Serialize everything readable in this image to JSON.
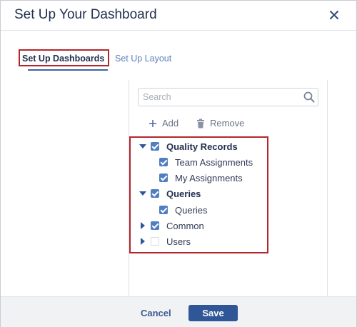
{
  "dialog": {
    "title": "Set Up Your Dashboard",
    "close_icon": "close-icon"
  },
  "tabs": [
    {
      "label": "Set Up Dashboards",
      "active": true
    },
    {
      "label": "Set Up Layout",
      "active": false
    }
  ],
  "search": {
    "placeholder": "Search",
    "value": "",
    "icon": "search-icon"
  },
  "actions": {
    "add_label": "Add",
    "add_icon": "plus-icon",
    "remove_label": "Remove",
    "remove_icon": "trash-icon"
  },
  "tree": [
    {
      "label": "Quality Records",
      "level": 0,
      "expanded": true,
      "checked": true
    },
    {
      "label": "Team Assignments",
      "level": 1,
      "checked": true
    },
    {
      "label": "My Assignments",
      "level": 1,
      "checked": true
    },
    {
      "label": "Queries",
      "level": 0,
      "expanded": true,
      "checked": true
    },
    {
      "label": "Queries",
      "level": 1,
      "checked": true
    },
    {
      "label": "Common",
      "level": 0,
      "expanded": false,
      "checked": true
    },
    {
      "label": "Users",
      "level": 0,
      "expanded": false,
      "checked": false
    }
  ],
  "footer": {
    "cancel_label": "Cancel",
    "save_label": "Save"
  },
  "colors": {
    "accent": "#2f5797",
    "checkbox": "#4f7ec2",
    "highlight_frame": "#b3262c"
  }
}
